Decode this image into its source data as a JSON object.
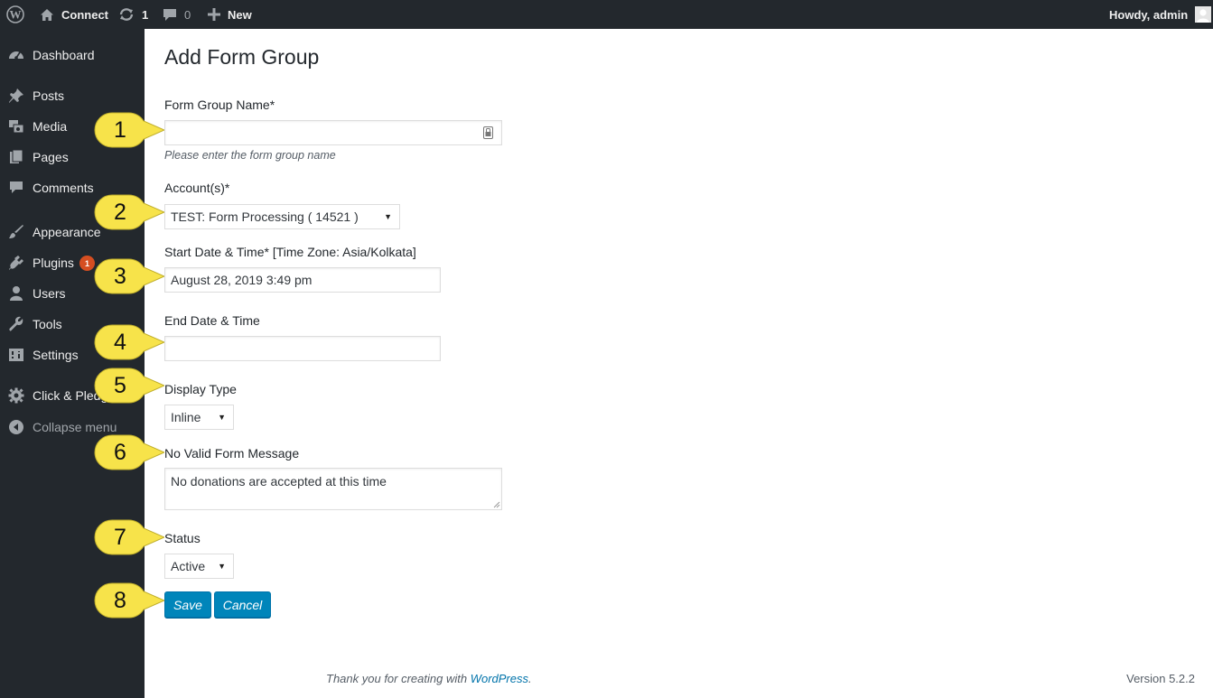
{
  "admin_bar": {
    "site_name": "Connect",
    "updates_count": "1",
    "comments_count": "0",
    "new_label": "New",
    "howdy": "Howdy, admin"
  },
  "sidebar": {
    "items": [
      {
        "label": "Dashboard",
        "icon": "dashboard-icon"
      },
      {
        "label": "Posts",
        "icon": "pin-icon"
      },
      {
        "label": "Media",
        "icon": "media-icon"
      },
      {
        "label": "Pages",
        "icon": "pages-icon"
      },
      {
        "label": "Comments",
        "icon": "comment-icon"
      },
      {
        "label": "Appearance",
        "icon": "brush-icon"
      },
      {
        "label": "Plugins",
        "icon": "plug-icon",
        "badge": "1"
      },
      {
        "label": "Users",
        "icon": "user-icon"
      },
      {
        "label": "Tools",
        "icon": "wrench-icon"
      },
      {
        "label": "Settings",
        "icon": "settings-icon"
      },
      {
        "label": "Click & Pledge",
        "icon": "gear-icon"
      },
      {
        "label": "Collapse menu",
        "icon": "collapse-icon"
      }
    ]
  },
  "form": {
    "title": "Add Form Group",
    "group_name_label": "Form Group Name*",
    "group_name_value": "",
    "group_name_hint": "Please enter the form group name",
    "accounts_label": "Account(s)*",
    "accounts_value": "TEST: Form Processing ( 14521 )",
    "start_label": "Start Date & Time* [Time Zone: Asia/Kolkata]",
    "start_value": "August 28, 2019 3:49 pm",
    "end_label": "End Date & Time",
    "end_value": "",
    "display_type_label": "Display Type",
    "display_type_value": "Inline",
    "no_valid_label": "No Valid Form Message",
    "no_valid_value": "No donations are accepted at this time",
    "status_label": "Status",
    "status_value": "Active",
    "save_label": "Save",
    "cancel_label": "Cancel"
  },
  "callouts": [
    "1",
    "2",
    "3",
    "4",
    "5",
    "6",
    "7",
    "8"
  ],
  "footer": {
    "thanks_prefix": "Thank you for creating with ",
    "thanks_link": "WordPress",
    "thanks_suffix": ".",
    "version": "Version 5.2.2"
  },
  "colors": {
    "admin_bar_bg": "#23282d",
    "primary_button": "#0085ba",
    "badge": "#d54e21",
    "callout": "#f7e34a"
  }
}
